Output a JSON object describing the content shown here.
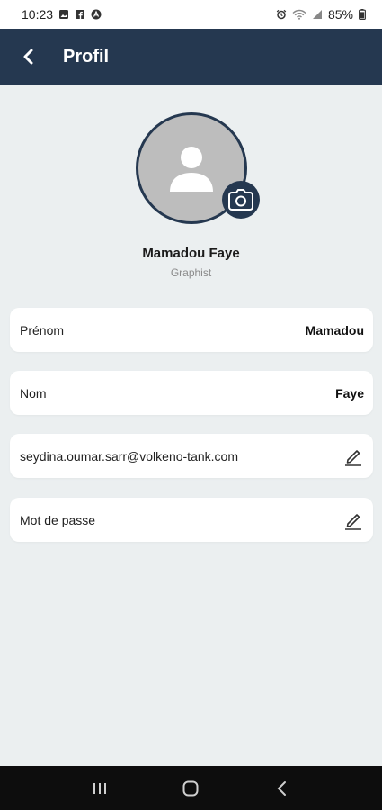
{
  "status": {
    "time": "10:23",
    "battery": "85%"
  },
  "header": {
    "title": "Profil"
  },
  "profile": {
    "name": "Mamadou Faye",
    "role": "Graphist"
  },
  "fields": [
    {
      "label": "Prénom",
      "value": "Mamadou"
    },
    {
      "label": "Nom",
      "value": "Faye"
    },
    {
      "label": "seydina.oumar.sarr@volkeno-tank.com"
    },
    {
      "label": "Mot de passe"
    }
  ],
  "colors": {
    "header_bg": "#253850",
    "page_bg": "#ebeff0",
    "card_bg": "#ffffff",
    "avatar_bg": "#bdbdbd"
  },
  "icons": {
    "back": "chevron-left-icon",
    "camera": "camera-icon",
    "edit": "pencil-icon",
    "avatar": "person-icon"
  }
}
